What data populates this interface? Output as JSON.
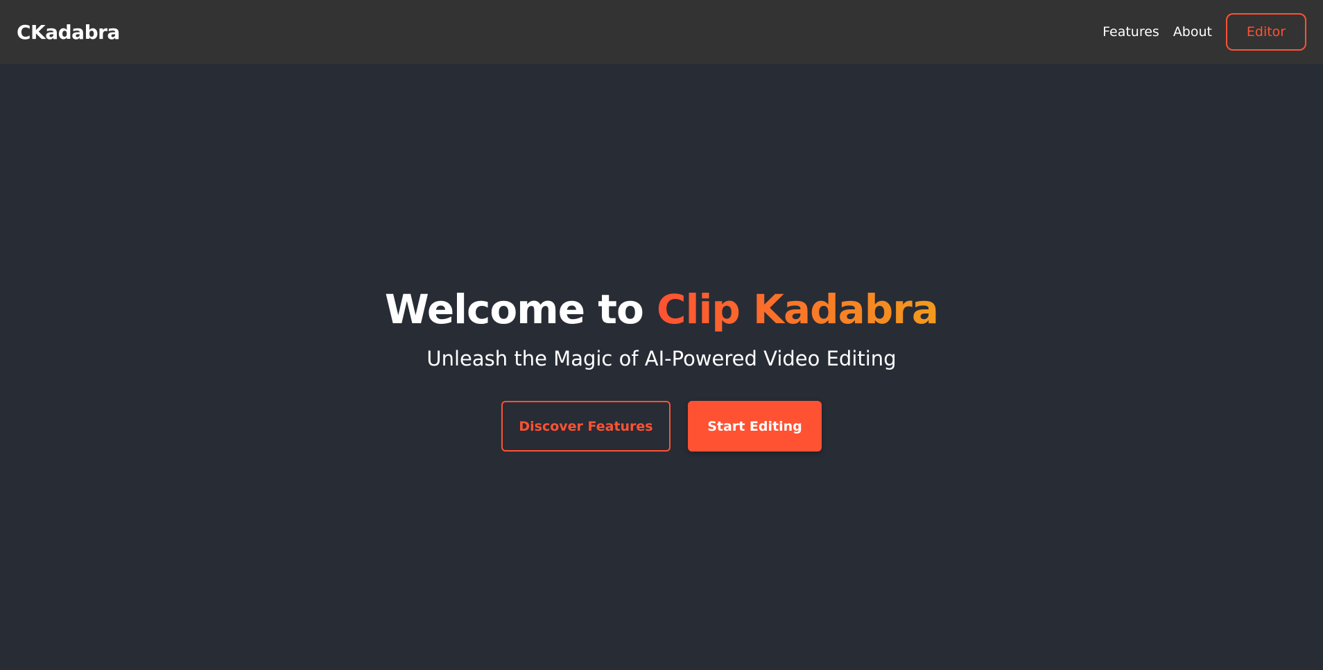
{
  "navbar": {
    "brand": "CKadabra",
    "links": [
      {
        "label": "Features"
      },
      {
        "label": "About"
      }
    ],
    "editor_label": "Editor"
  },
  "hero": {
    "title_prefix": "Welcome to ",
    "title_accent": "Clip Kadabra",
    "subtitle": "Unleash the Magic of AI-Powered Video Editing",
    "discover_label": "Discover Features",
    "start_label": "Start Editing"
  },
  "colors": {
    "background": "#282c35",
    "navbar": "#333333",
    "accent": "#ff5233",
    "accent_gradient_end": "#f39a1e",
    "text": "#ffffff"
  }
}
